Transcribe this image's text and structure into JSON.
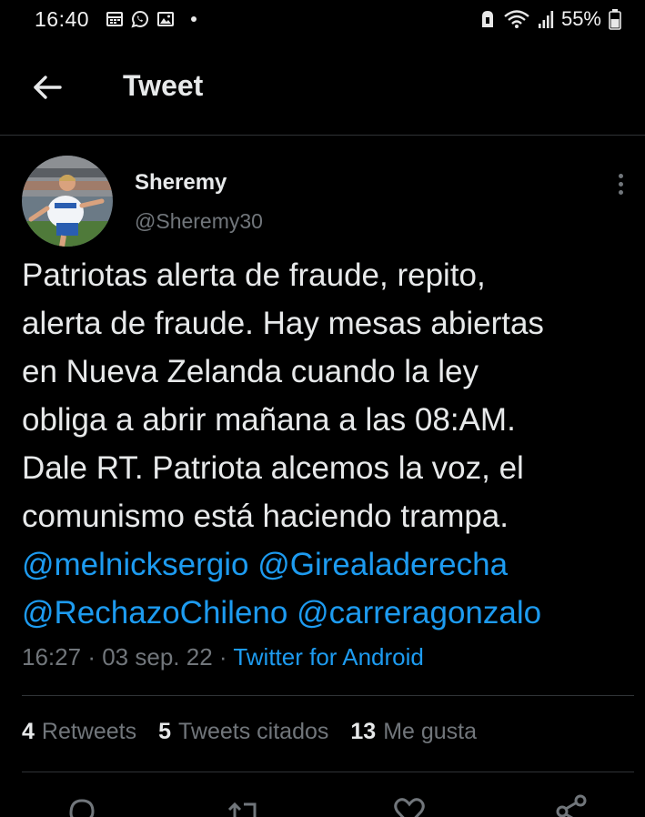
{
  "status_bar": {
    "time": "16:40",
    "battery": "55%",
    "icons_left": [
      "calendar-icon",
      "whatsapp-icon",
      "gallery-icon",
      "notification-dot"
    ],
    "icons_right": [
      "alarm-icon",
      "wifi-icon",
      "signal-icon",
      "battery-icon"
    ]
  },
  "header": {
    "title": "Tweet",
    "back_icon": "arrow-left-icon"
  },
  "tweet": {
    "author_name": "Sheremy",
    "author_handle": "@Sheremy30",
    "text_lines": [
      "Patriotas alerta de fraude, repito,",
      "alerta de fraude. Hay mesas abiertas",
      "en Nueva Zelanda cuando la ley",
      "obliga a abrir mañana a las 08:AM.",
      "Dale RT. Patriota alcemos la voz, el",
      "comunismo está haciendo trampa."
    ],
    "mentions": [
      "@melnicksergio",
      "@Girealaderecha",
      "@RechazoChileno",
      "@carreragonzalo"
    ],
    "time": "16:27",
    "date": "03 sep. 22",
    "separator": "·",
    "source": "Twitter for Android"
  },
  "stats": {
    "retweets_count": "4",
    "retweets_label": "Retweets",
    "quotes_count": "5",
    "quotes_label": "Tweets citados",
    "likes_count": "13",
    "likes_label": "Me gusta"
  },
  "colors": {
    "background": "#000000",
    "text": "#e7e9ea",
    "muted": "#71767b",
    "accent": "#1d9bf0",
    "divider": "#2f3336"
  }
}
